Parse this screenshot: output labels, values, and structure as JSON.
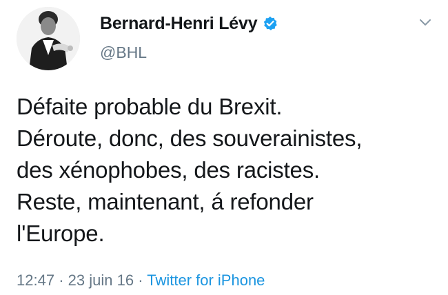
{
  "user": {
    "display_name": "Bernard-Henri Lévy",
    "handle": "@BHL",
    "verified": true
  },
  "tweet": {
    "lines": [
      "Défaite probable du Brexit.",
      "Déroute, donc, des souverainistes,",
      "des xénophobes, des racistes.",
      "Reste, maintenant, á refonder",
      "l'Europe."
    ],
    "time": "12:47",
    "separator": "·",
    "date": "23 juin 16",
    "source": "Twitter for iPhone"
  },
  "icons": {
    "verified": "verified-badge-icon",
    "menu": "chevron-down-icon"
  },
  "colors": {
    "text": "#14171a",
    "secondary": "#657786",
    "link": "#1b95e0",
    "verified": "#1da1f2"
  }
}
